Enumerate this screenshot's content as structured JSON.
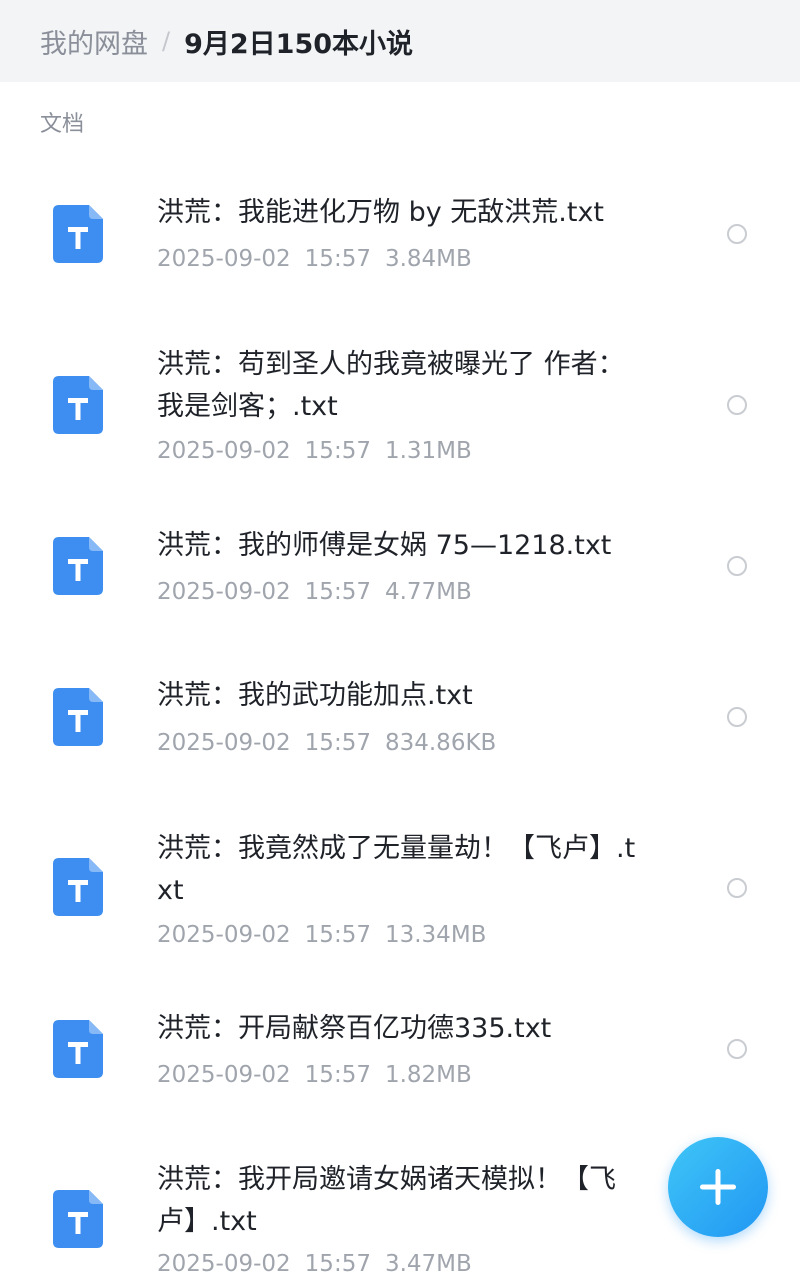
{
  "header": {
    "root": "我的网盘",
    "separator": "/",
    "current": "9月2日150本小说"
  },
  "section_label": "文档",
  "icons": {
    "file": "txt-file-icon",
    "file_color": "#3d8ef0",
    "fab": "plus-icon"
  },
  "files": [
    {
      "name": "洪荒：我能进化万物 by 无敌洪荒.txt",
      "date": "2025-09-02",
      "time": "15:57",
      "size": "3.84MB"
    },
    {
      "name": "洪荒：苟到圣人的我竟被曝光了 作者：我是剑客；.txt",
      "date": "2025-09-02",
      "time": "15:57",
      "size": "1.31MB"
    },
    {
      "name": "洪荒：我的师傅是女娲 75—1218.txt",
      "date": "2025-09-02",
      "time": "15:57",
      "size": "4.77MB"
    },
    {
      "name": "洪荒：我的武功能加点.txt",
      "date": "2025-09-02",
      "time": "15:57",
      "size": "834.86KB"
    },
    {
      "name": "洪荒：我竟然成了无量量劫！【飞卢】.txt",
      "date": "2025-09-02",
      "time": "15:57",
      "size": "13.34MB"
    },
    {
      "name": "洪荒：开局献祭百亿功德335.txt",
      "date": "2025-09-02",
      "time": "15:57",
      "size": "1.82MB"
    },
    {
      "name": "洪荒：我开局邀请女娲诸天模拟！【飞卢】.txt",
      "date": "2025-09-02",
      "time": "15:57",
      "size": "3.47MB"
    }
  ]
}
